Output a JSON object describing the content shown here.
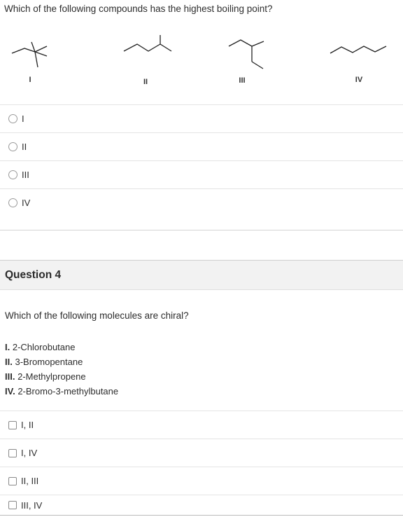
{
  "question3": {
    "prompt": "Which of the following compounds has the highest boiling point?",
    "structure_labels": [
      "I",
      "II",
      "III",
      "IV"
    ],
    "options": [
      {
        "label": "I"
      },
      {
        "label": "II"
      },
      {
        "label": "III"
      },
      {
        "label": "IV"
      }
    ]
  },
  "question4": {
    "title": "Question 4",
    "prompt": "Which of the following molecules are chiral?",
    "statements": [
      {
        "num": "I.",
        "text": "2-Chlorobutane"
      },
      {
        "num": "II.",
        "text": "3-Bromopentane"
      },
      {
        "num": "III.",
        "text": "2-Methylpropene"
      },
      {
        "num": "IV.",
        "text": "2-Bromo-3-methylbutane"
      }
    ],
    "options": [
      {
        "label": "I, II"
      },
      {
        "label": "I, IV"
      },
      {
        "label": "II, III"
      },
      {
        "label": "III, IV"
      }
    ]
  }
}
